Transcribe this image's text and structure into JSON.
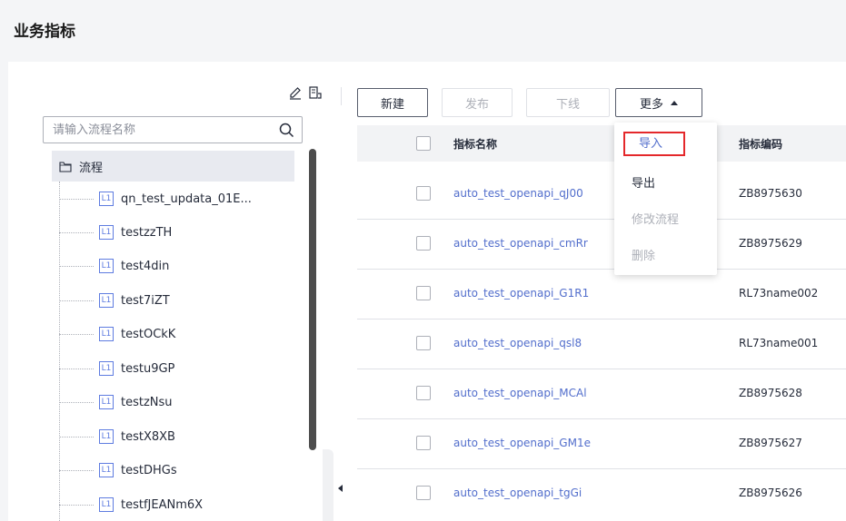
{
  "page": {
    "title": "业务指标"
  },
  "tree": {
    "search_placeholder": "请输入流程名称",
    "root_label": "流程",
    "level_badge": "L1",
    "items": [
      "qn_test_updata_01E...",
      "testzzTH",
      "test4din",
      "test7iZT",
      "testOCkK",
      "testu9GP",
      "testzNsu",
      "testX8XB",
      "testDHGs",
      "testfJEANm6X"
    ]
  },
  "toolbar": {
    "new_label": "新建",
    "publish_label": "发布",
    "offline_label": "下线",
    "more_label": "更多"
  },
  "dropdown": {
    "items": [
      {
        "label": "导入",
        "highlighted": true,
        "enabled": true
      },
      {
        "label": "导出",
        "enabled": true
      },
      {
        "label": "修改流程",
        "enabled": false
      },
      {
        "label": "删除",
        "enabled": false
      }
    ]
  },
  "table": {
    "columns": [
      "指标名称",
      "指标编码"
    ],
    "rows": [
      {
        "name": "auto_test_openapi_qJ00",
        "code": "ZB8975630"
      },
      {
        "name": "auto_test_openapi_cmRr",
        "code": "ZB8975629"
      },
      {
        "name": "auto_test_openapi_G1R1",
        "code": "RL73name002"
      },
      {
        "name": "auto_test_openapi_qsl8",
        "code": "RL73name001"
      },
      {
        "name": "auto_test_openapi_MCAl",
        "code": "ZB8975628"
      },
      {
        "name": "auto_test_openapi_GM1e",
        "code": "ZB8975627"
      },
      {
        "name": "auto_test_openapi_tgGi",
        "code": "ZB8975626"
      }
    ]
  },
  "colors": {
    "link": "#526ecc",
    "highlight_border": "#e4282b",
    "disabled": "#adb0b8"
  }
}
